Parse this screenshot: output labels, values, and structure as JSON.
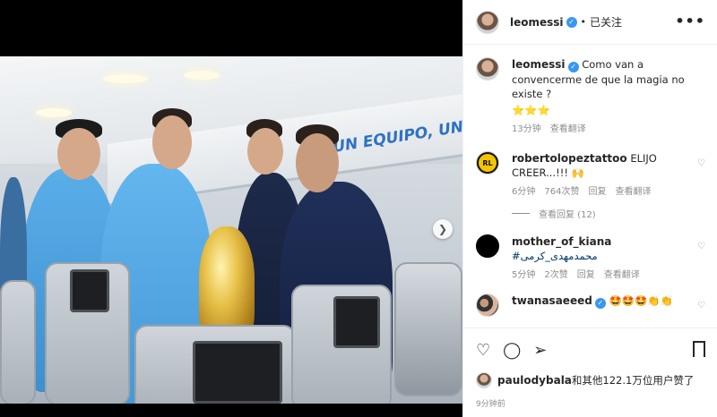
{
  "post": {
    "author": "leomessi",
    "follow_status": "已关注",
    "more_icon": "more-horizontal-icon",
    "banner_text": "UN EQUIPO, UN PAÍS, UN S",
    "caption": {
      "author": "leomessi",
      "text": "Como van a convencerme de que la magia no existe ?",
      "emojis": "⭐⭐⭐",
      "time": "13分钟",
      "translate": "查看翻译"
    },
    "comments": [
      {
        "author": "robertolopeztattoo",
        "text": "ELIJO CREER...!!! 🙌",
        "time": "6分钟",
        "likes": "764次赞",
        "reply": "回复",
        "translate": "查看翻译",
        "view_replies": "查看回复 (12)"
      },
      {
        "author": "mother_of_kiana",
        "text": "#محمدمهدی_کرمی",
        "time": "5分钟",
        "likes": "2次赞",
        "reply": "回复",
        "translate": "查看翻译"
      },
      {
        "author": "twanasaeeed",
        "text": "🤩🤩🤩👏👏"
      }
    ],
    "liked_by": "paulodybala",
    "liked_summary": "和其他122.1万位用户赞了",
    "posted_time": "9分钟前"
  },
  "colors": {
    "verified": "#3897f0",
    "hashtag": "#00376b",
    "muted": "#8e8e8e"
  }
}
